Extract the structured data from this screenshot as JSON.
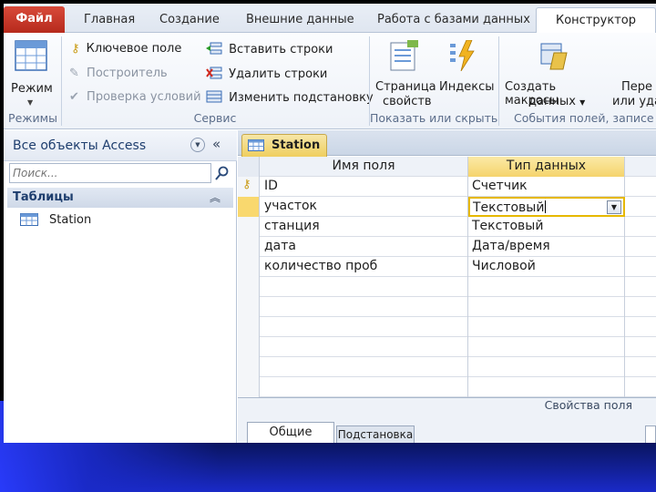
{
  "ribbon_tabs": {
    "file": "Файл",
    "home": "Главная",
    "create": "Создание",
    "external": "Внешние данные",
    "database_tools": "Работа с базами данных",
    "design": "Конструктор"
  },
  "ribbon": {
    "view_button": "Режим",
    "group_views": "Режимы",
    "primary_key": "Ключевое поле",
    "builder": "Построитель",
    "test_validation": "Проверка условий",
    "insert_rows": "Вставить строки",
    "delete_rows": "Удалить строки",
    "modify_lookups": "Изменить подстановку",
    "group_tools": "Сервис",
    "property_sheet_l1": "Страница",
    "property_sheet_l2": "свойств",
    "indexes": "Индексы",
    "group_showhide": "Показать или скрыть",
    "create_macros_l1": "Создать макросы",
    "create_macros_l2": "данных",
    "rename_l1": "Пере",
    "rename_l2": "или уда",
    "group_events": "События полей, записе"
  },
  "nav": {
    "title": "Все объекты Access",
    "search_placeholder": "Поиск...",
    "group_tables": "Таблицы",
    "items": [
      {
        "label": "Station"
      }
    ]
  },
  "document": {
    "tab_label": "Station",
    "col_field_name": "Имя поля",
    "col_data_type": "Тип данных",
    "rows": [
      {
        "name": "ID",
        "type": "Счетчик",
        "primary_key": true
      },
      {
        "name": "участок",
        "type": "Текстовый",
        "selected": true
      },
      {
        "name": "станция",
        "type": "Текстовый"
      },
      {
        "name": "дата",
        "type": "Дата/время"
      },
      {
        "name": "количество проб",
        "type": "Числовой"
      }
    ],
    "field_properties_label": "Свойства поля",
    "prop_tab_general": "Общие",
    "prop_tab_lookup": "Подстановка"
  }
}
